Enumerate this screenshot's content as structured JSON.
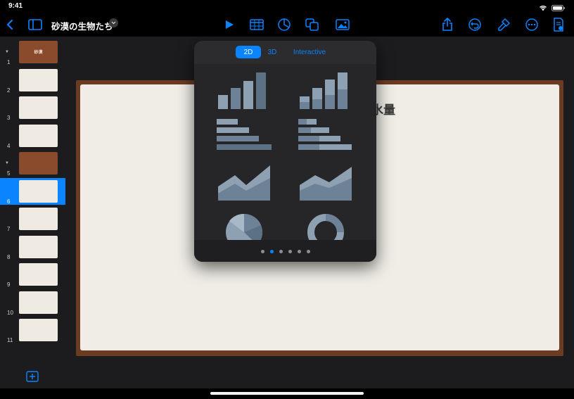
{
  "status_bar": {
    "time": "9:41"
  },
  "document": {
    "title": "砂漠の生物たち"
  },
  "toolbar": {
    "left": [
      "back-icon",
      "sidebar-toggle-icon"
    ],
    "center": [
      "play-icon",
      "table-icon",
      "chart-icon",
      "shapes-icon",
      "media-icon"
    ],
    "right": [
      "share-icon",
      "undo-icon",
      "format-brush-icon",
      "more-icon",
      "document-settings-icon"
    ],
    "accent": "#0a84ff"
  },
  "slides": [
    {
      "number": "1",
      "label": "砂漠",
      "style": "brown",
      "collapsible": true
    },
    {
      "number": "2",
      "style": "light"
    },
    {
      "number": "3",
      "style": "light"
    },
    {
      "number": "4",
      "style": "light"
    },
    {
      "number": "5",
      "style": "brown",
      "collapsible": true
    },
    {
      "number": "6",
      "style": "light",
      "selected": true
    },
    {
      "number": "7",
      "style": "light"
    },
    {
      "number": "8",
      "style": "light"
    },
    {
      "number": "9",
      "style": "light"
    },
    {
      "number": "10",
      "style": "light"
    },
    {
      "number": "11",
      "style": "light"
    }
  ],
  "slide": {
    "title_fragment": "水量"
  },
  "chart_popover": {
    "tabs": [
      {
        "label": "2D",
        "active": true
      },
      {
        "label": "3D",
        "active": false
      },
      {
        "label": "Interactive",
        "active": false
      }
    ],
    "chart_types": [
      "column-chart",
      "stacked-column-chart",
      "bar-chart",
      "stacked-bar-chart",
      "area-chart",
      "stacked-area-chart",
      "pie-chart",
      "donut-chart"
    ],
    "page_count": 6,
    "current_page": 2
  }
}
